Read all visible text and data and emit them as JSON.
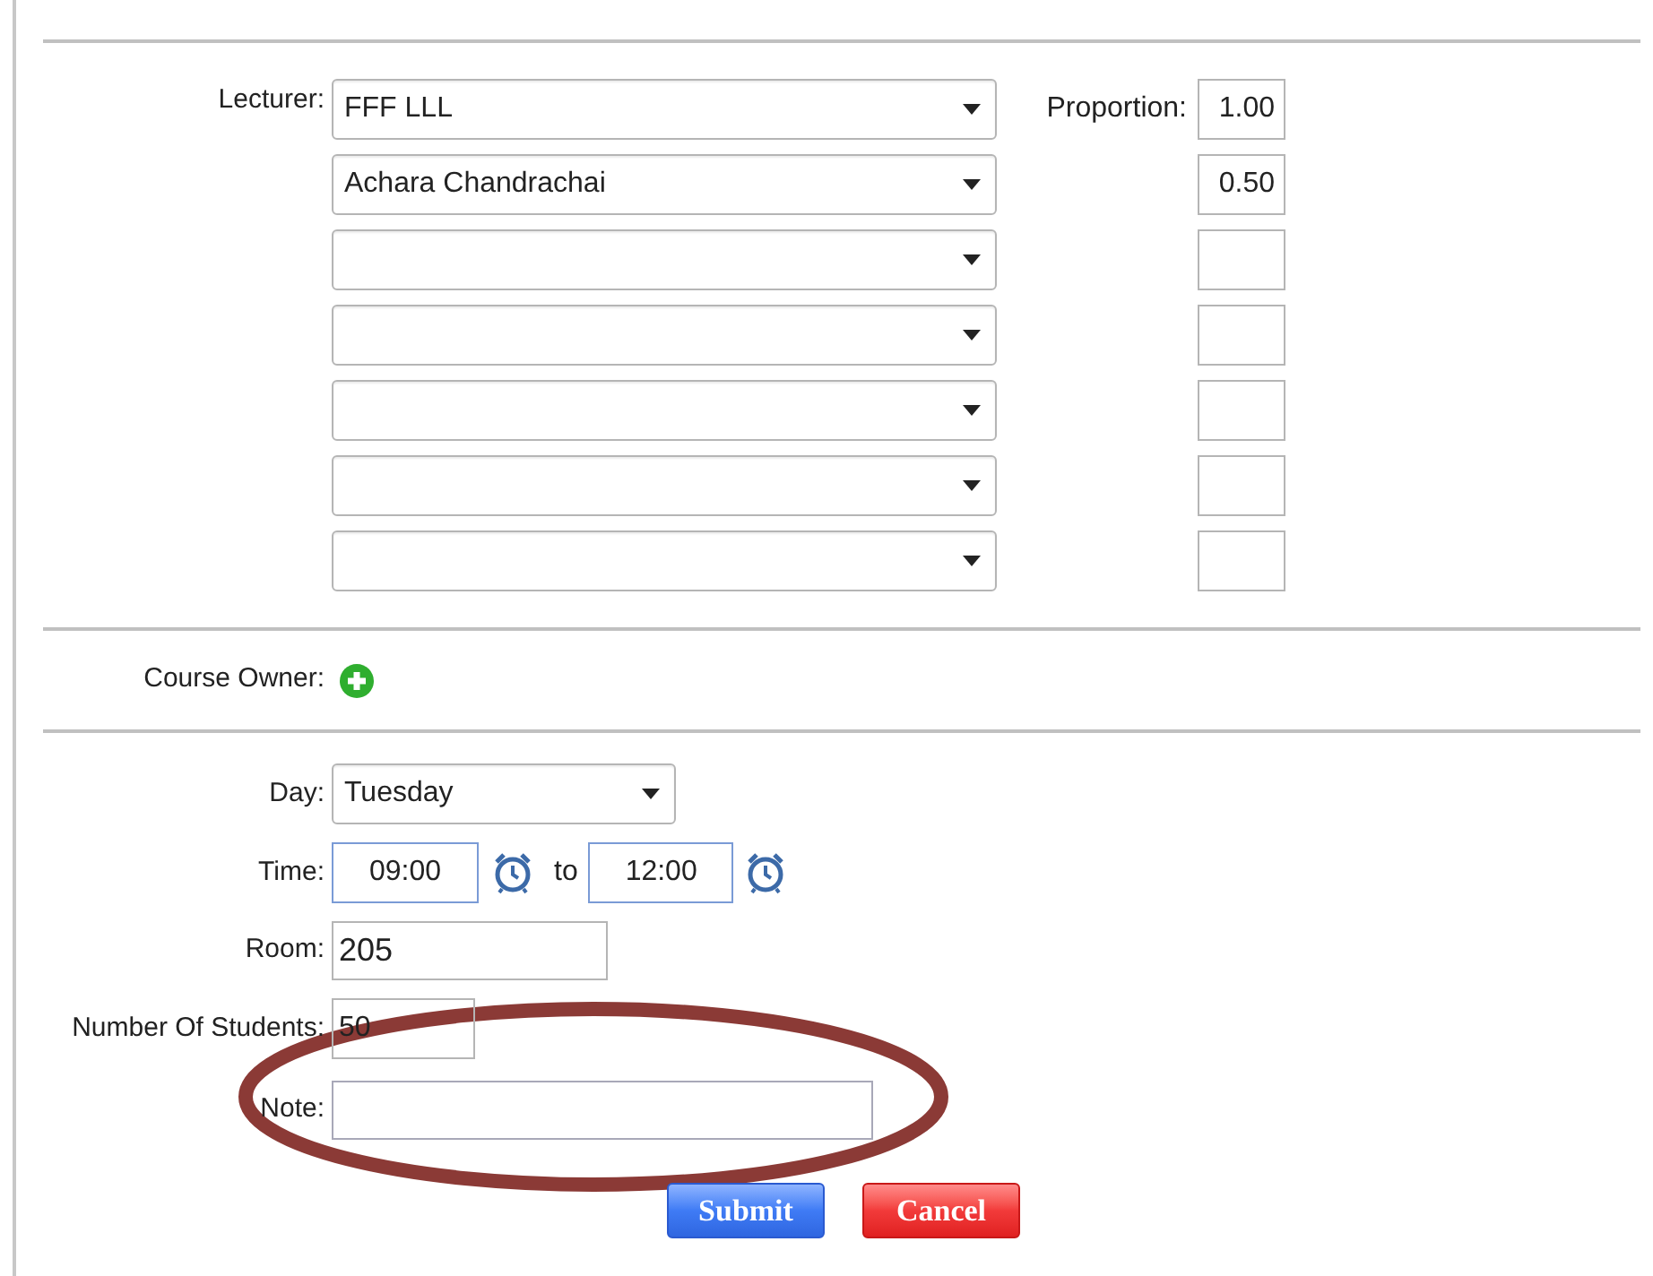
{
  "lecturers": {
    "label": "Lecturer:",
    "proportion_label": "Proportion:",
    "rows": [
      {
        "kind": "filled",
        "value": "FFF LLL",
        "proportion": "1.00"
      },
      {
        "kind": "filled",
        "value": "Achara Chandrachai",
        "proportion": "0.50"
      },
      {
        "kind": "empty"
      },
      {
        "kind": "empty"
      },
      {
        "kind": "empty"
      },
      {
        "kind": "empty"
      },
      {
        "kind": "empty"
      }
    ]
  },
  "course_owner": {
    "label": "Course Owner:"
  },
  "day": {
    "label": "Day:",
    "value": "Tuesday"
  },
  "time": {
    "label": "Time:",
    "from": "09:00",
    "separator": "to",
    "to": "12:00"
  },
  "room": {
    "label": "Room:",
    "value": "205"
  },
  "students": {
    "label": "Number Of Students:",
    "value": "50"
  },
  "note": {
    "label": "Note:"
  },
  "buttons": [
    {
      "label": "Submit",
      "kind": "primary"
    },
    {
      "label": "Cancel",
      "kind": "danger"
    }
  ]
}
